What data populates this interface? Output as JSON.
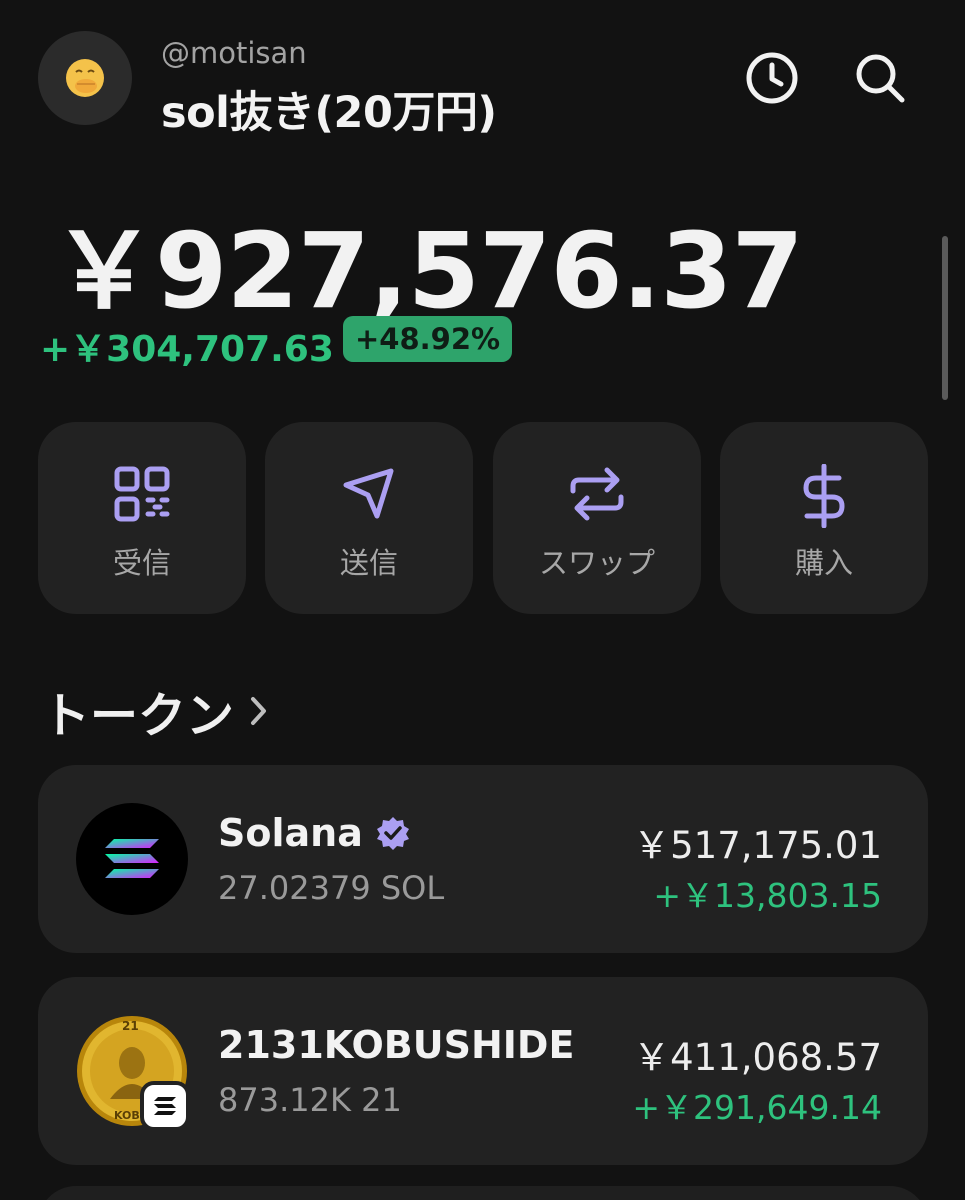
{
  "header": {
    "avatar_icon": "hand-over-mouth-emoji-icon",
    "username": "@motisan",
    "account_name": "sol抜き(20万円)",
    "history_icon": "clock-icon",
    "search_icon": "search-icon"
  },
  "balance": {
    "total": "￥927,576.37",
    "change_amount": "+￥304,707.63",
    "change_percent": "+48.92%"
  },
  "actions": [
    {
      "label": "受信",
      "icon": "qr-code-icon"
    },
    {
      "label": "送信",
      "icon": "send-icon"
    },
    {
      "label": "スワップ",
      "icon": "swap-icon"
    },
    {
      "label": "購入",
      "icon": "dollar-icon"
    }
  ],
  "tokens_section": {
    "title": "トークン"
  },
  "tokens": [
    {
      "name": "Solana",
      "verified": true,
      "quantity": "27.02379 SOL",
      "value": "￥517,175.01",
      "gain": "+￥13,803.15"
    },
    {
      "name": "2131KOBUSHIDE",
      "verified": false,
      "quantity": "873.12K 21",
      "value": "￥411,068.57",
      "gain": "+￥291,649.14",
      "coin_engraving": "21",
      "coin_text": "KOBU"
    }
  ],
  "colors": {
    "background": "#121212",
    "card": "#222222",
    "accent_purple": "#ab9ff2",
    "positive_green": "#2ec27e"
  }
}
